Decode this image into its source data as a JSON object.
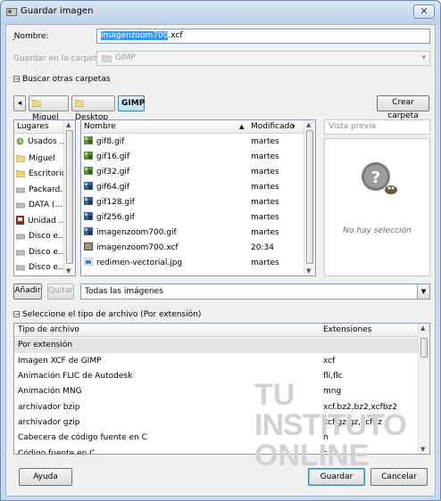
{
  "window": {
    "title": "Guardar imagen",
    "close_glyph": "✕"
  },
  "name_field": {
    "label": "Nombre:",
    "value_selected": "imagenzoom700",
    "value_rest": ".xcf"
  },
  "folder_field": {
    "label": "Guardar en la carpeta:",
    "value": "GIMP"
  },
  "browse_toggle": {
    "label": "Buscar otras carpetas",
    "glyph": "−"
  },
  "path": {
    "back_glyph": "◂",
    "segments": [
      "Miguel",
      "Desktop",
      "GIMP"
    ],
    "active": "GIMP",
    "create_folder": "Crear carpeta"
  },
  "places": {
    "header": "Lugares",
    "items": [
      {
        "label": "Usados ...",
        "icon": "recent-icon"
      },
      {
        "label": "Miguel",
        "icon": "folder-icon"
      },
      {
        "label": "Escritorio",
        "icon": "folder-icon"
      },
      {
        "label": "Packard...",
        "icon": "drive-icon"
      },
      {
        "label": "DATA (...",
        "icon": "drive-icon"
      },
      {
        "label": "Unidad ...",
        "icon": "media-icon"
      },
      {
        "label": "Disco e...",
        "icon": "drive-icon"
      },
      {
        "label": "Disco e...",
        "icon": "drive-icon"
      },
      {
        "label": "Disco e...",
        "icon": "drive-icon"
      }
    ],
    "add_button": "Añadir",
    "remove_button": "Quitar"
  },
  "files": {
    "col_name": "Nombre",
    "col_modified": "Modificado",
    "sort_glyph": "▲",
    "rows": [
      {
        "name": "gif8.gif",
        "modified": "martes"
      },
      {
        "name": "gif16.gif",
        "modified": "martes"
      },
      {
        "name": "gif32.gif",
        "modified": "martes"
      },
      {
        "name": "gif64.gif",
        "modified": "martes"
      },
      {
        "name": "gif128.gif",
        "modified": "martes"
      },
      {
        "name": "gif256.gif",
        "modified": "martes"
      },
      {
        "name": "imagenzoom700.gif",
        "modified": "martes"
      },
      {
        "name": "imagenzoom700.xcf",
        "modified": "20:34"
      },
      {
        "name": "redimen-vectorial.jpg",
        "modified": "martes"
      }
    ],
    "filter": "Todas las imágenes"
  },
  "preview": {
    "header": "Vista previa",
    "empty_text": "No hay selección"
  },
  "filetype": {
    "toggle_label": "Seleccione el tipo de archivo (Por extensión)",
    "col_type": "Tipo de archivo",
    "col_ext": "Extensiones",
    "rows": [
      {
        "type": "Por extensión",
        "ext": ""
      },
      {
        "type": "Imagen XCF de GIMP",
        "ext": "xcf"
      },
      {
        "type": "Animación FLIC de Autodesk",
        "ext": "fli,flc"
      },
      {
        "type": "Animación MNG",
        "ext": "mng"
      },
      {
        "type": "archivador bzip",
        "ext": "xcf.bz2,bz2,xcfbz2"
      },
      {
        "type": "archivador gzip",
        "ext": "xcf.gz,gz,xcfgz"
      },
      {
        "type": "Cabecera de código fuente en C",
        "ext": "h"
      },
      {
        "type": "Código fuente en C",
        "ext": "c"
      }
    ]
  },
  "buttons": {
    "help": "Ayuda",
    "save": "Guardar",
    "cancel": "Cancelar"
  },
  "watermark": {
    "line1": "TU",
    "line2": "INSTITUTO",
    "line3": "ONLINE"
  }
}
